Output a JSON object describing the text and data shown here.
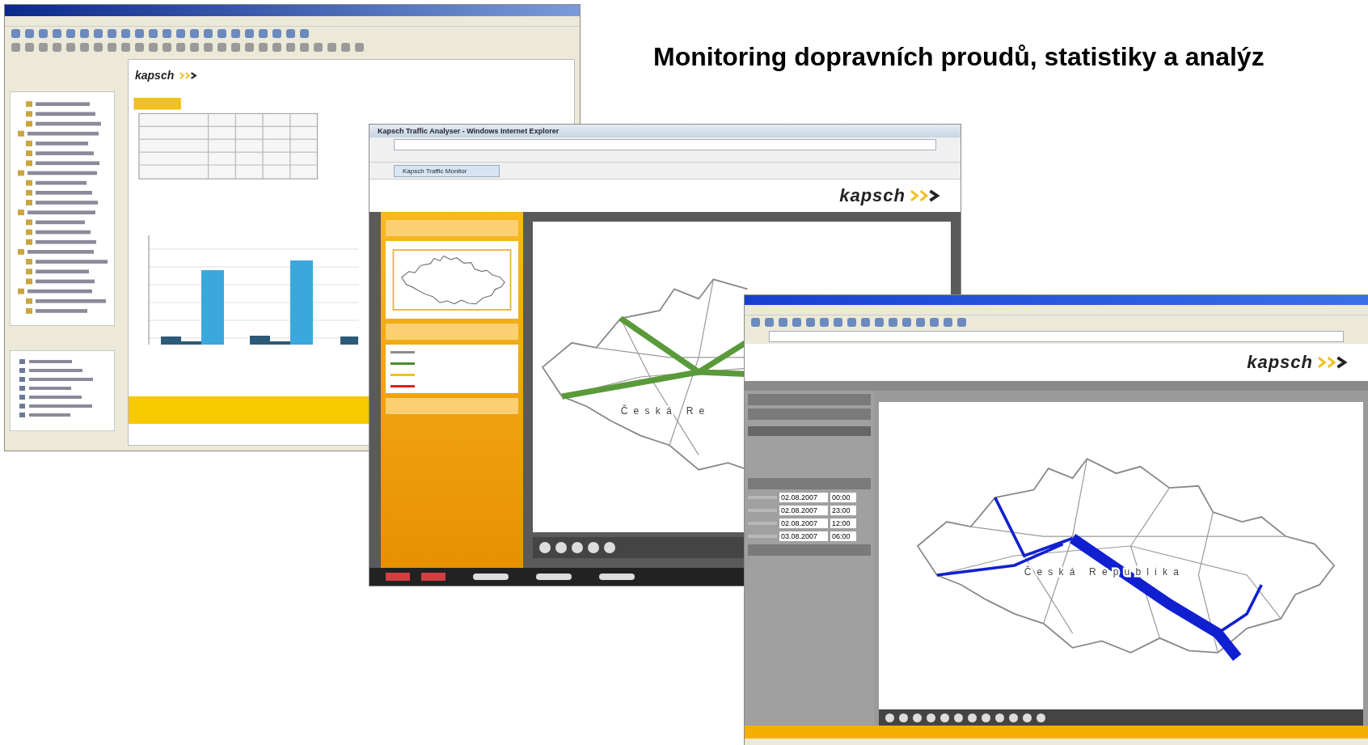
{
  "slide": {
    "heading": "Monitoring dopravních proudů, statistiky a analýz"
  },
  "analysis_window": {
    "logo": "kapsch"
  },
  "monitor_window": {
    "title": "Kapsch Traffic Analyser - Windows Internet Explorer",
    "tab": "Kapsch Traffic Monitor",
    "logo": "kapsch",
    "map_label": "Česká Re",
    "legend": [
      {
        "color": "#8c8c8c"
      },
      {
        "color": "#4e8a2c"
      },
      {
        "color": "#f0c020"
      },
      {
        "color": "#e02020"
      }
    ]
  },
  "report_window": {
    "logo": "kapsch",
    "map_label": "Česká Republika",
    "date_rows": [
      {
        "date": "02.08.2007",
        "time": "00:00"
      },
      {
        "date": "02.08.2007",
        "time": "23:00"
      },
      {
        "date": "02.08.2007",
        "time": "12:00"
      },
      {
        "date": "03.08.2007",
        "time": "06:00"
      }
    ]
  }
}
